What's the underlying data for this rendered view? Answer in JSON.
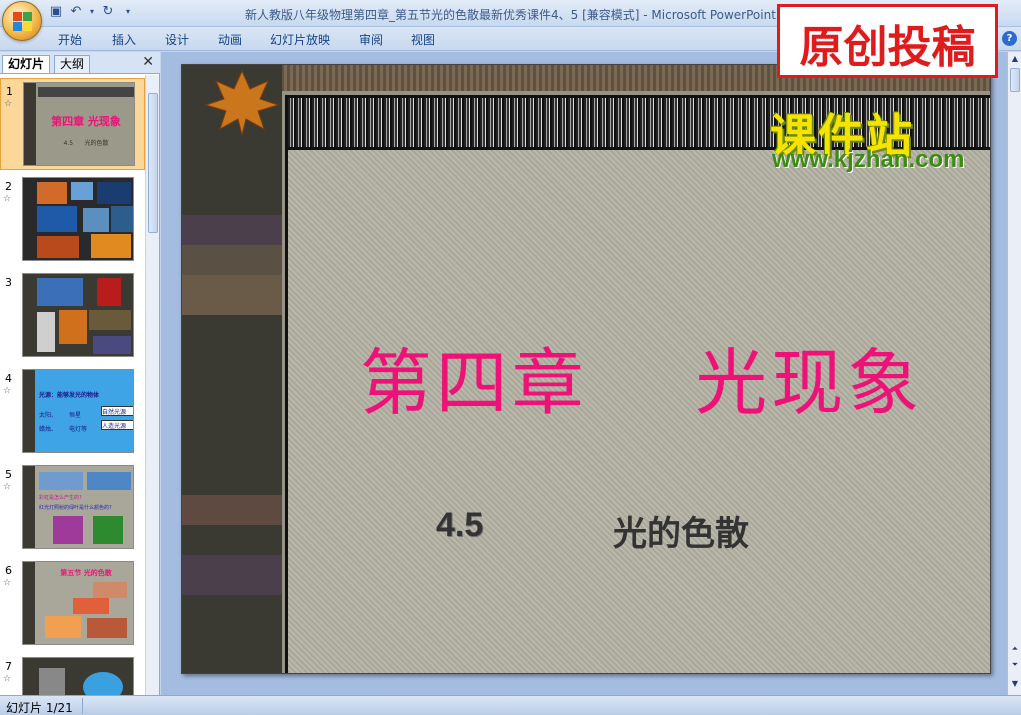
{
  "window": {
    "title": "新人教版八年级物理第四章_第五节光的色散最新优秀课件4、5 [兼容模式] - Microsoft PowerPoint"
  },
  "ribbon": {
    "tabs": [
      "开始",
      "插入",
      "设计",
      "动画",
      "幻灯片放映",
      "审阅",
      "视图"
    ]
  },
  "left_pane": {
    "tab_slides": "幻灯片",
    "tab_outline": "大纲",
    "thumbnails": [
      {
        "num": "1",
        "title": "第四章  光现象",
        "subtitle": "4.5      光的色散"
      },
      {
        "num": "2"
      },
      {
        "num": "3"
      },
      {
        "num": "4",
        "line1": "光源：能够发光的物体",
        "line2a": "太阳、",
        "line2b": "恒星",
        "box1": "自然光源",
        "line3a": "蜡烛、",
        "line3b": "电灯等",
        "box2": "人造光源"
      },
      {
        "num": "5",
        "line1": "彩虹是怎么产生的?",
        "line2": "红光灯照射的绿叶是什么颜色的?"
      },
      {
        "num": "6",
        "title": "第五节 光的色散"
      },
      {
        "num": "7"
      }
    ]
  },
  "slide": {
    "title": "第四章    光现象",
    "subtitle_num": "4.5",
    "subtitle_text": "光的色散"
  },
  "watermark": {
    "stamp": "原创投稿",
    "site_name": "课件站",
    "site_url": "www.kjzhan.com"
  },
  "status_bar": {
    "text": "幻灯片 1/21"
  }
}
